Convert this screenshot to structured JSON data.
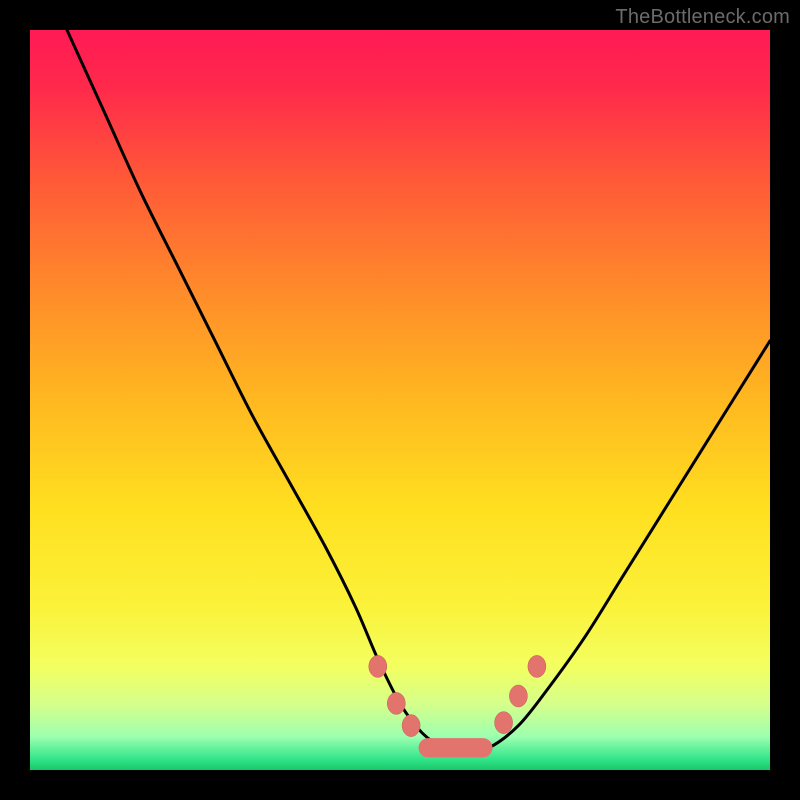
{
  "watermark": {
    "text": "TheBottleneck.com"
  },
  "colors": {
    "background": "#000000",
    "gradient_stops": [
      {
        "offset": 0.0,
        "color": "#ff1a55"
      },
      {
        "offset": 0.08,
        "color": "#ff2a4b"
      },
      {
        "offset": 0.2,
        "color": "#ff5838"
      },
      {
        "offset": 0.35,
        "color": "#ff8a2a"
      },
      {
        "offset": 0.5,
        "color": "#ffb820"
      },
      {
        "offset": 0.65,
        "color": "#ffe020"
      },
      {
        "offset": 0.78,
        "color": "#fbf23a"
      },
      {
        "offset": 0.86,
        "color": "#f3ff60"
      },
      {
        "offset": 0.91,
        "color": "#d6ff8a"
      },
      {
        "offset": 0.955,
        "color": "#9dffb0"
      },
      {
        "offset": 0.985,
        "color": "#33e58a"
      },
      {
        "offset": 1.0,
        "color": "#18c768"
      }
    ],
    "curve": "#000000",
    "marker_fill": "#e2746d",
    "marker_stroke": "#c85a55"
  },
  "chart_data": {
    "type": "line",
    "title": "",
    "xlabel": "",
    "ylabel": "",
    "xlim": [
      0,
      100
    ],
    "ylim": [
      0,
      100
    ],
    "series": [
      {
        "name": "bottleneck-curve",
        "x": [
          5,
          10,
          15,
          20,
          25,
          30,
          35,
          40,
          44,
          47,
          50,
          53,
          56,
          59,
          62,
          66,
          70,
          75,
          80,
          85,
          90,
          95,
          100
        ],
        "y": [
          100,
          89,
          78,
          68,
          58,
          48,
          39,
          30,
          22,
          15,
          9,
          5,
          3,
          2.5,
          3,
          6,
          11,
          18,
          26,
          34,
          42,
          50,
          58
        ]
      }
    ],
    "markers": {
      "name": "highlight-points",
      "x": [
        47.0,
        49.5,
        51.5,
        54.0,
        56.5,
        59.0,
        61.5,
        64.0,
        66.0,
        68.5
      ],
      "y": [
        14.0,
        9.0,
        6.0,
        4.0,
        3.3,
        3.3,
        4.2,
        6.4,
        10.0,
        14.0
      ]
    },
    "flat_band": {
      "x_start": 52.5,
      "x_end": 62.5,
      "y": 3.0,
      "thickness": 2.6
    }
  }
}
